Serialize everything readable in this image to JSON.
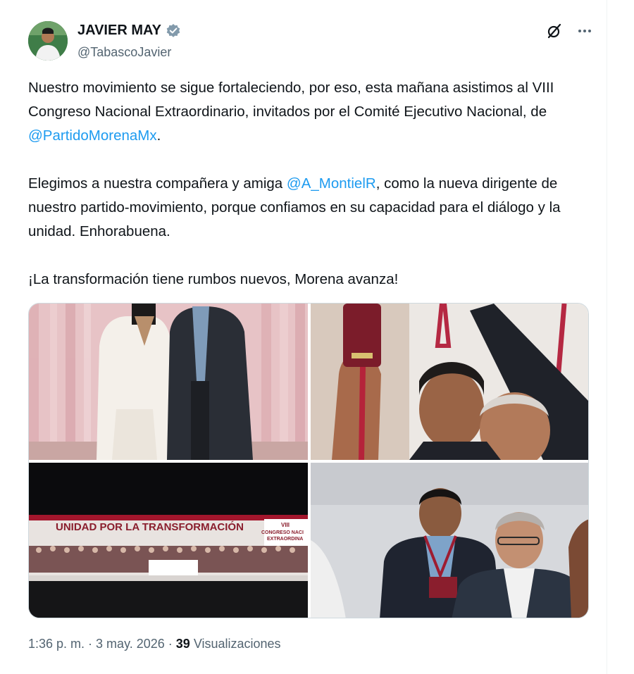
{
  "author": {
    "name": "JAVIER MAY",
    "handle": "@TabascoJavier"
  },
  "tweet": {
    "para1_a": "Nuestro movimiento se sigue fortaleciendo, por eso, esta mañana asistimos al VIII Congreso Nacional Extraordinario, invitados por el Comité Ejecutivo Nacional, de ",
    "mention1": "@PartidoMorenaMx",
    "para1_b": ".",
    "para2_a": "Elegimos a nuestra compañera y amiga ",
    "mention2": "@A_MontielR",
    "para2_b": ", como la nueva dirigente de nuestro partido-movimiento, porque confiamos en su capacidad para el diálogo y la unidad. Enhorabuena.",
    "para3": "¡La transformación tiene rumbos nuevos, Morena avanza!"
  },
  "photos": {
    "banner_text": "UNIDAD POR LA TRANSFORMACIÓN",
    "banner_badge_num": "VIII",
    "banner_badge_l1": "CONGRESO NACI",
    "banner_badge_l2": "EXTRAORDINA"
  },
  "meta": {
    "time": "1:36 p. m.",
    "sep1": "·",
    "date": "3 may. 2026",
    "sep2": "·",
    "views_count": "39",
    "views_label": "Visualizaciones"
  },
  "colors": {
    "mention": "#1d9bf0",
    "verified_badge": "#829aab",
    "secondary_text": "#536471"
  }
}
